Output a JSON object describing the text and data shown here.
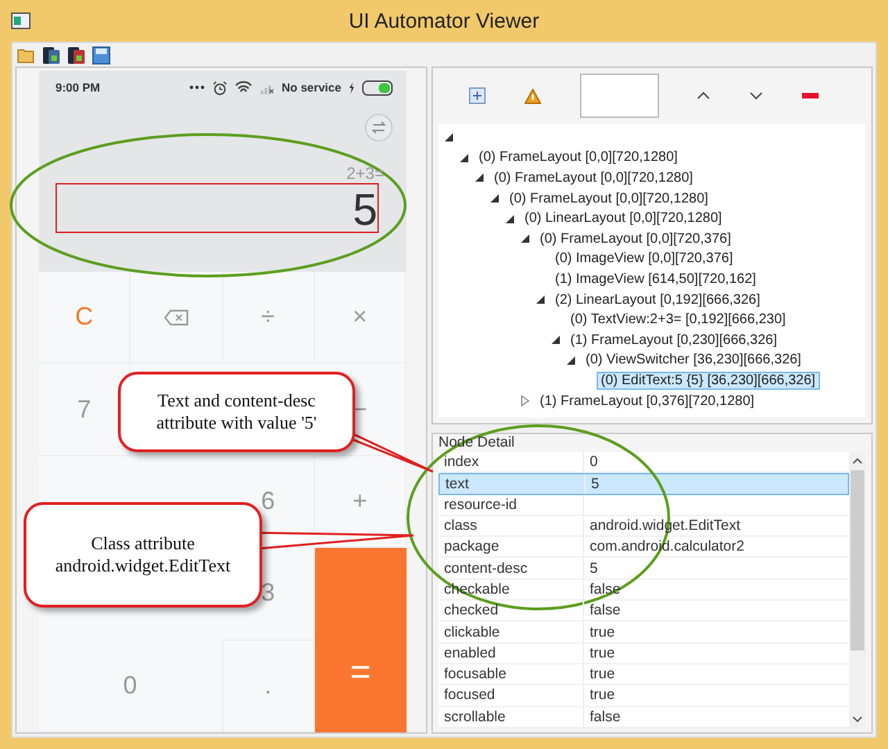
{
  "window": {
    "title": "UI Automator Viewer"
  },
  "phone": {
    "status_bar": {
      "time": "9:00 PM",
      "carrier": "No service"
    },
    "display": {
      "expression": "2+3=",
      "result": "5",
      "result_highlighted": true
    },
    "keys": [
      {
        "kind": "clear",
        "label": "C"
      },
      {
        "kind": "backspace"
      },
      {
        "kind": "op",
        "label": "÷"
      },
      {
        "kind": "op",
        "label": "×"
      },
      {
        "kind": "digit",
        "label": "7"
      },
      {
        "kind": "op",
        "label": "−"
      },
      {
        "kind": "digit",
        "label": "6"
      },
      {
        "kind": "op",
        "label": "+"
      },
      {
        "kind": "digit",
        "label": "3"
      },
      {
        "kind": "digit",
        "label": "0"
      },
      {
        "kind": "digit",
        "label": "."
      },
      {
        "kind": "equals",
        "label": "="
      }
    ]
  },
  "tree": [
    {
      "kind": "branch",
      "expanded": true,
      "children": [
        {
          "label": "(0) FrameLayout [0,0][720,1280]",
          "kind": "branch",
          "expanded": true,
          "selected": false,
          "children": [
            {
              "label": "(0) FrameLayout [0,0][720,1280]",
              "kind": "branch",
              "expanded": true,
              "selected": false,
              "children": [
                {
                  "label": "(0) FrameLayout [0,0][720,1280]",
                  "kind": "branch",
                  "expanded": true,
                  "selected": false,
                  "children": [
                    {
                      "label": "(0) LinearLayout [0,0][720,1280]",
                      "kind": "branch",
                      "expanded": true,
                      "selected": false,
                      "children": [
                        {
                          "label": "(0) FrameLayout [0,0][720,376]",
                          "kind": "branch",
                          "expanded": true,
                          "selected": false,
                          "children": [
                            {
                              "label": "(0) ImageView [0,0][720,376]",
                              "kind": "leaf",
                              "selected": false
                            },
                            {
                              "label": "(1) ImageView [614,50][720,162]",
                              "kind": "leaf",
                              "selected": false
                            },
                            {
                              "label": "(2) LinearLayout [0,192][666,326]",
                              "kind": "branch",
                              "expanded": true,
                              "selected": false,
                              "children": [
                                {
                                  "label": "(0) TextView:2+3= [0,192][666,230]",
                                  "kind": "leaf",
                                  "selected": false
                                },
                                {
                                  "label": "(1) FrameLayout [0,230][666,326]",
                                  "kind": "branch",
                                  "expanded": true,
                                  "selected": false,
                                  "children": [
                                    {
                                      "label": "(0) ViewSwitcher [36,230][666,326]",
                                      "kind": "branch",
                                      "expanded": true,
                                      "selected": false,
                                      "children": [
                                        {
                                          "label": "(0) EditText:5 {5} [36,230][666,326]",
                                          "kind": "leaf",
                                          "selected": true
                                        }
                                      ]
                                    }
                                  ]
                                }
                              ]
                            }
                          ]
                        },
                        {
                          "label": "(1) FrameLayout [0,376][720,1280]",
                          "kind": "branch",
                          "expanded": false,
                          "selected": false
                        }
                      ]
                    }
                  ]
                }
              ]
            }
          ]
        }
      ]
    }
  ],
  "node_detail": {
    "title": "Node Detail",
    "rows": [
      {
        "key": "index",
        "value": "0",
        "selected": false
      },
      {
        "key": "text",
        "value": "5",
        "selected": true
      },
      {
        "key": "resource-id",
        "selected": false
      },
      {
        "key": "class",
        "value": "android.widget.EditText",
        "selected": false
      },
      {
        "key": "package",
        "value": "com.android.calculator2",
        "selected": false
      },
      {
        "key": "content-desc",
        "value": "5",
        "selected": false
      },
      {
        "key": "checkable",
        "value": "false",
        "selected": false
      },
      {
        "key": "checked",
        "value": "false",
        "selected": false
      },
      {
        "key": "clickable",
        "value": "true",
        "selected": false
      },
      {
        "key": "enabled",
        "value": "true",
        "selected": false
      },
      {
        "key": "focusable",
        "value": "true",
        "selected": false
      },
      {
        "key": "focused",
        "value": "true",
        "selected": false
      },
      {
        "key": "scrollable",
        "value": "false",
        "selected": false
      }
    ]
  },
  "callouts": [
    "Text and content-desc attribute with value '5'",
    "Class attribute android.widget.EditText"
  ]
}
